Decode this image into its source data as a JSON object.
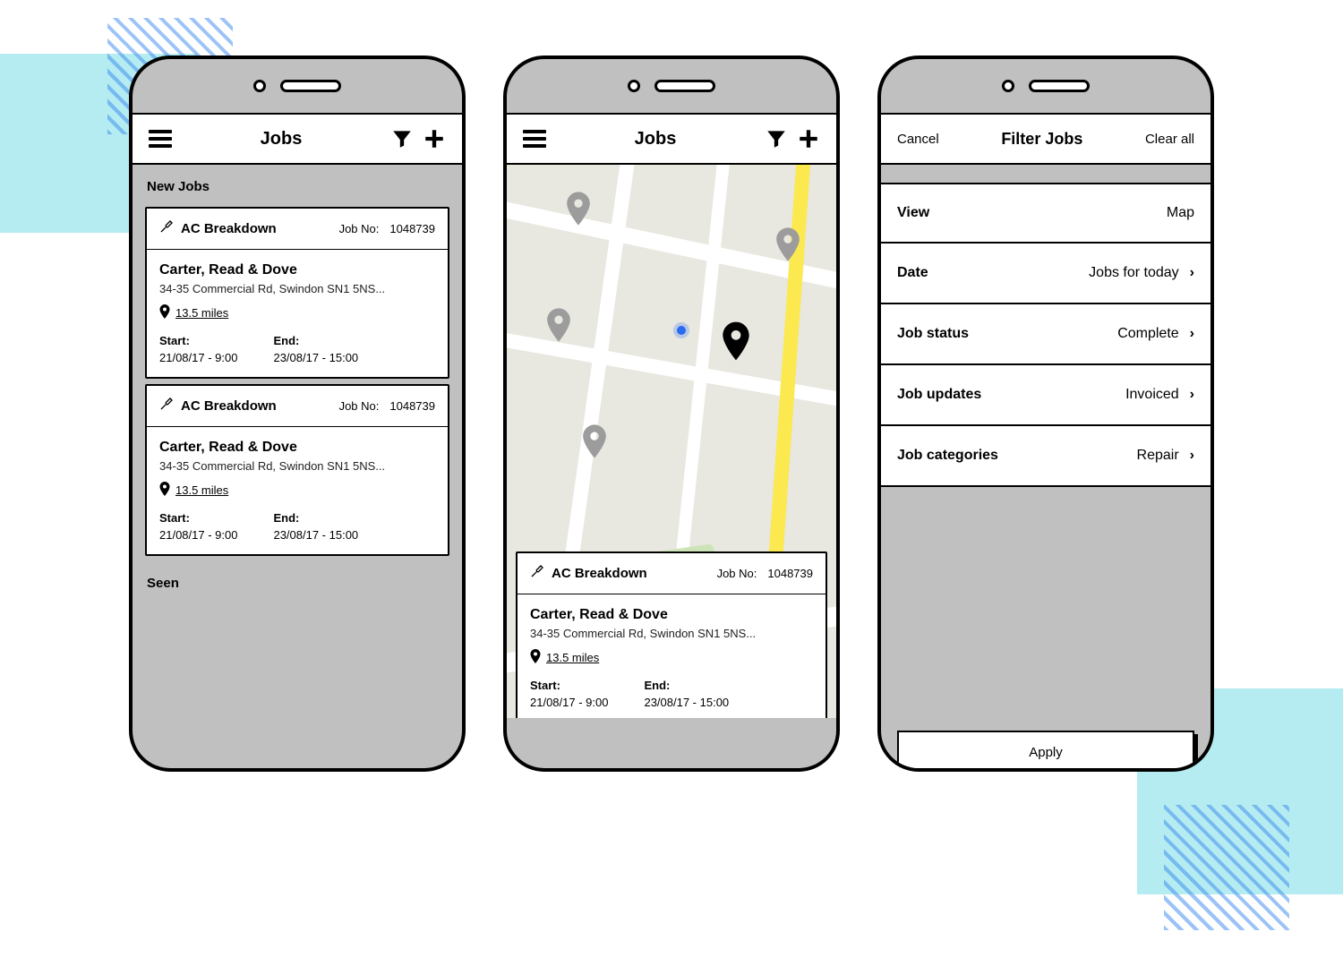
{
  "screen1": {
    "title": "Jobs",
    "section_new": "New Jobs",
    "section_seen": "Seen",
    "job_no_label": "Job No:",
    "start_label": "Start:",
    "end_label": "End:",
    "cards": [
      {
        "type": "AC Breakdown",
        "job_no": "1048739",
        "client": "Carter, Read & Dove",
        "address": "34-35 Commercial Rd, Swindon SN1 5NS...",
        "distance": "13.5 miles",
        "start": "21/08/17 - 9:00",
        "end": "23/08/17 - 15:00"
      },
      {
        "type": "AC Breakdown",
        "job_no": "1048739",
        "client": "Carter, Read & Dove",
        "address": "34-35 Commercial Rd, Swindon SN1 5NS...",
        "distance": "13.5 miles",
        "start": "21/08/17 - 9:00",
        "end": "23/08/17 - 15:00"
      }
    ]
  },
  "screen2": {
    "title": "Jobs",
    "job_no_label": "Job No:",
    "start_label": "Start:",
    "end_label": "End:",
    "card": {
      "type": "AC Breakdown",
      "job_no": "1048739",
      "client": "Carter, Read & Dove",
      "address": "34-35 Commercial Rd, Swindon SN1 5NS...",
      "distance": "13.5 miles",
      "start": "21/08/17 - 9:00",
      "end": "23/08/17 - 15:00"
    }
  },
  "screen3": {
    "cancel": "Cancel",
    "title": "Filter Jobs",
    "clear": "Clear all",
    "apply": "Apply",
    "rows": [
      {
        "label": "View",
        "value": "Map",
        "chevron": false
      },
      {
        "label": "Date",
        "value": "Jobs for today",
        "chevron": true
      },
      {
        "label": "Job status",
        "value": "Complete",
        "chevron": true
      },
      {
        "label": "Job updates",
        "value": "Invoiced",
        "chevron": true
      },
      {
        "label": "Job categories",
        "value": "Repair",
        "chevron": true
      }
    ]
  }
}
